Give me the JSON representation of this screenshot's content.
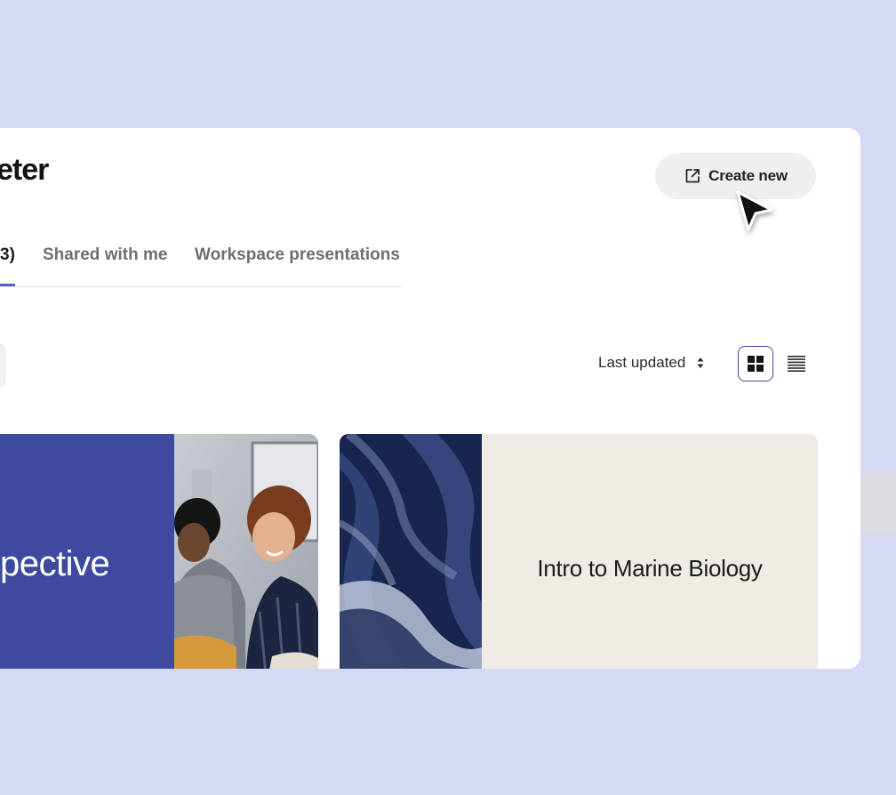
{
  "app": {
    "title": "eter"
  },
  "toolbar": {
    "create_label": "Create new",
    "create_icon": "external-link-icon"
  },
  "tabs": [
    {
      "label": "3)",
      "active": true
    },
    {
      "label": "Shared with me",
      "active": false
    },
    {
      "label": "Workspace presentations",
      "active": false
    }
  ],
  "controls": {
    "sort_label": "Last updated",
    "sort_icon": "sort-updown-icon",
    "grid_view_icon": "grid-view-icon",
    "list_view_icon": "list-view-icon",
    "active_view": "grid"
  },
  "cards": [
    {
      "title": "pective",
      "accent": "#3e4aa0",
      "image": "people-photo"
    },
    {
      "title": "Intro to Marine Biology",
      "accent": "#f0ece5",
      "image": "blue-texture"
    }
  ],
  "colors": {
    "background": "#d6d9f5",
    "accent": "#5a5fc2",
    "card_blue": "#3e4aa0",
    "card_beige": "#f0ece5"
  }
}
